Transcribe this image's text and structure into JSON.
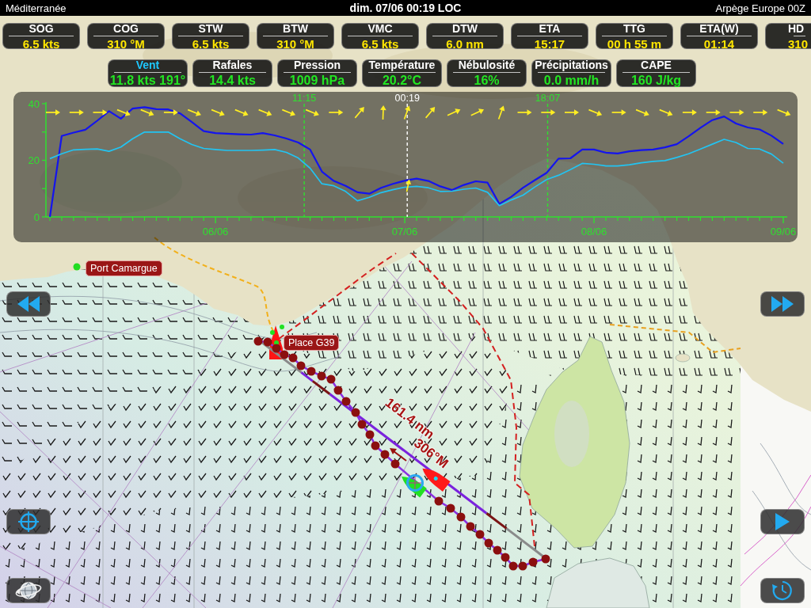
{
  "top_bar": {
    "region": "Méditerranée",
    "datetime": "dim. 07/06 00:19 LOC",
    "model": "Arpège Europe 00Z"
  },
  "navigation_instruments": [
    {
      "label": "SOG",
      "value": "6.5 kts"
    },
    {
      "label": "COG",
      "value": "310 °M"
    },
    {
      "label": "STW",
      "value": "6.5 kts"
    },
    {
      "label": "BTW",
      "value": "310 °M"
    },
    {
      "label": "VMC",
      "value": "6.5 kts"
    },
    {
      "label": "DTW",
      "value": "6.0 nm"
    },
    {
      "label": "ETA",
      "value": "15:17"
    },
    {
      "label": "TTG",
      "value": "00 h 55 m"
    },
    {
      "label": "ETA(W)",
      "value": "01:14"
    },
    {
      "label": "HD",
      "value": "310"
    }
  ],
  "weather_instruments": [
    {
      "label": "Vent",
      "value": "11.8 kts 191°",
      "selected": true
    },
    {
      "label": "Rafales",
      "value": "14.4 kts",
      "selected": false
    },
    {
      "label": "Pression",
      "value": "1009 hPa",
      "selected": false
    },
    {
      "label": "Température",
      "value": "20.2°C",
      "selected": false
    },
    {
      "label": "Nébulosité",
      "value": "16%",
      "selected": false
    },
    {
      "label": "Précipitations",
      "value": "0.0 mm/h",
      "selected": false
    },
    {
      "label": "CAPE",
      "value": "160 J/kg",
      "selected": false
    }
  ],
  "forecast_chart": {
    "chart_data": {
      "type": "line",
      "categories": [
        null,
        null,
        null,
        null,
        null,
        null,
        null,
        null,
        null,
        null,
        null,
        null,
        null,
        null,
        "06/06",
        null,
        null,
        null,
        null,
        null,
        null,
        null,
        null,
        null,
        null,
        null,
        null,
        null,
        null,
        null,
        "07/06",
        null,
        null,
        null,
        null,
        null,
        null,
        null,
        null,
        null,
        null,
        null,
        null,
        null,
        null,
        null,
        "08/06",
        null,
        null,
        null,
        null,
        null,
        null,
        null,
        null,
        null,
        null,
        null,
        null,
        null,
        null,
        null,
        "09/06"
      ],
      "series": [
        {
          "color": "#1414ee",
          "values": [
            0,
            28.6,
            29.8,
            30.8,
            34,
            37.4,
            34.7,
            38.3,
            38.8,
            38.1,
            38,
            36.6,
            33.5,
            30.3,
            29.6,
            29.4,
            29.2,
            29.1,
            29.6,
            28.8,
            27.7,
            26.3,
            23.8,
            16,
            12.7,
            11,
            8.7,
            8.2,
            10.3,
            11.7,
            12.8,
            13.5,
            12.7,
            10.8,
            9.5,
            11.3,
            12.6,
            12.1,
            4.6,
            7.1,
            10.3,
            13,
            15.6,
            20.6,
            20.7,
            23.8,
            23.8,
            22.7,
            22.4,
            23.2,
            23.6,
            23.8,
            24.6,
            25.7,
            28.5,
            31.5,
            34.2,
            35.5,
            33,
            31.6,
            30.9,
            28.7,
            25.8
          ]
        },
        {
          "color": "#22c4f2",
          "values": [
            20.6,
            22.3,
            23.7,
            23.9,
            24,
            23.2,
            24.7,
            27.6,
            30,
            30,
            30,
            27.6,
            25.6,
            24.2,
            23.8,
            23.5,
            23.5,
            23.5,
            23.6,
            23.8,
            22.8,
            20.8,
            17.2,
            11.7,
            11,
            9,
            5.7,
            6.9,
            8.6,
            9.6,
            10.5,
            10.8,
            10.3,
            9,
            9.1,
            9.8,
            10.2,
            8.7,
            4,
            6,
            7.7,
            10.6,
            13.2,
            14.7,
            16.7,
            18.9,
            18.6,
            18,
            18,
            18.4,
            19.1,
            19.6,
            19.9,
            21,
            22.3,
            24,
            25.7,
            27.4,
            26.3,
            24.2,
            24,
            22.2,
            19
          ]
        }
      ],
      "ylim": [
        0,
        40
      ],
      "yticks": [
        0,
        20,
        40
      ],
      "annotations": [
        "11:15",
        "00:19",
        "18:07"
      ]
    },
    "direction_arrows": [
      {
        "kind": "east"
      },
      {
        "kind": "east"
      },
      {
        "kind": "east"
      },
      {
        "kind": "east-southeast"
      },
      {
        "kind": "east-southeast"
      },
      {
        "kind": "east"
      },
      {
        "kind": "east-southeast"
      },
      {
        "kind": "east-southeast"
      },
      {
        "kind": "east-southeast"
      },
      {
        "kind": "east-southeast"
      },
      {
        "kind": "east-southeast"
      },
      {
        "kind": "east-southeast"
      },
      {
        "kind": "east"
      },
      {
        "kind": "northeast"
      },
      {
        "kind": "north"
      },
      {
        "kind": "north-northeast"
      },
      {
        "kind": "northeast"
      },
      {
        "kind": "east-northeast"
      },
      {
        "kind": "east-northeast"
      },
      {
        "kind": "north-northeast"
      },
      {
        "kind": "east"
      },
      {
        "kind": "east"
      },
      {
        "kind": "east"
      },
      {
        "kind": "east-southeast"
      },
      {
        "kind": "east"
      },
      {
        "kind": "east-southeast"
      },
      {
        "kind": "east-southeast"
      },
      {
        "kind": "east"
      },
      {
        "kind": "east"
      },
      {
        "kind": "east"
      },
      {
        "kind": "east"
      },
      {
        "kind": "east-southeast"
      }
    ]
  },
  "map": {
    "places": [
      {
        "label": "Port Camargue",
        "kind": "port"
      },
      {
        "label": "Place G39",
        "kind": "mark"
      }
    ],
    "route": {
      "distance": "161.4 nm",
      "bearing": "306°M"
    }
  },
  "controls": [
    {
      "kind": "rewind"
    },
    {
      "kind": "fast-forward"
    },
    {
      "kind": "center"
    },
    {
      "kind": "play"
    },
    {
      "kind": "globe"
    },
    {
      "kind": "clock"
    }
  ]
}
